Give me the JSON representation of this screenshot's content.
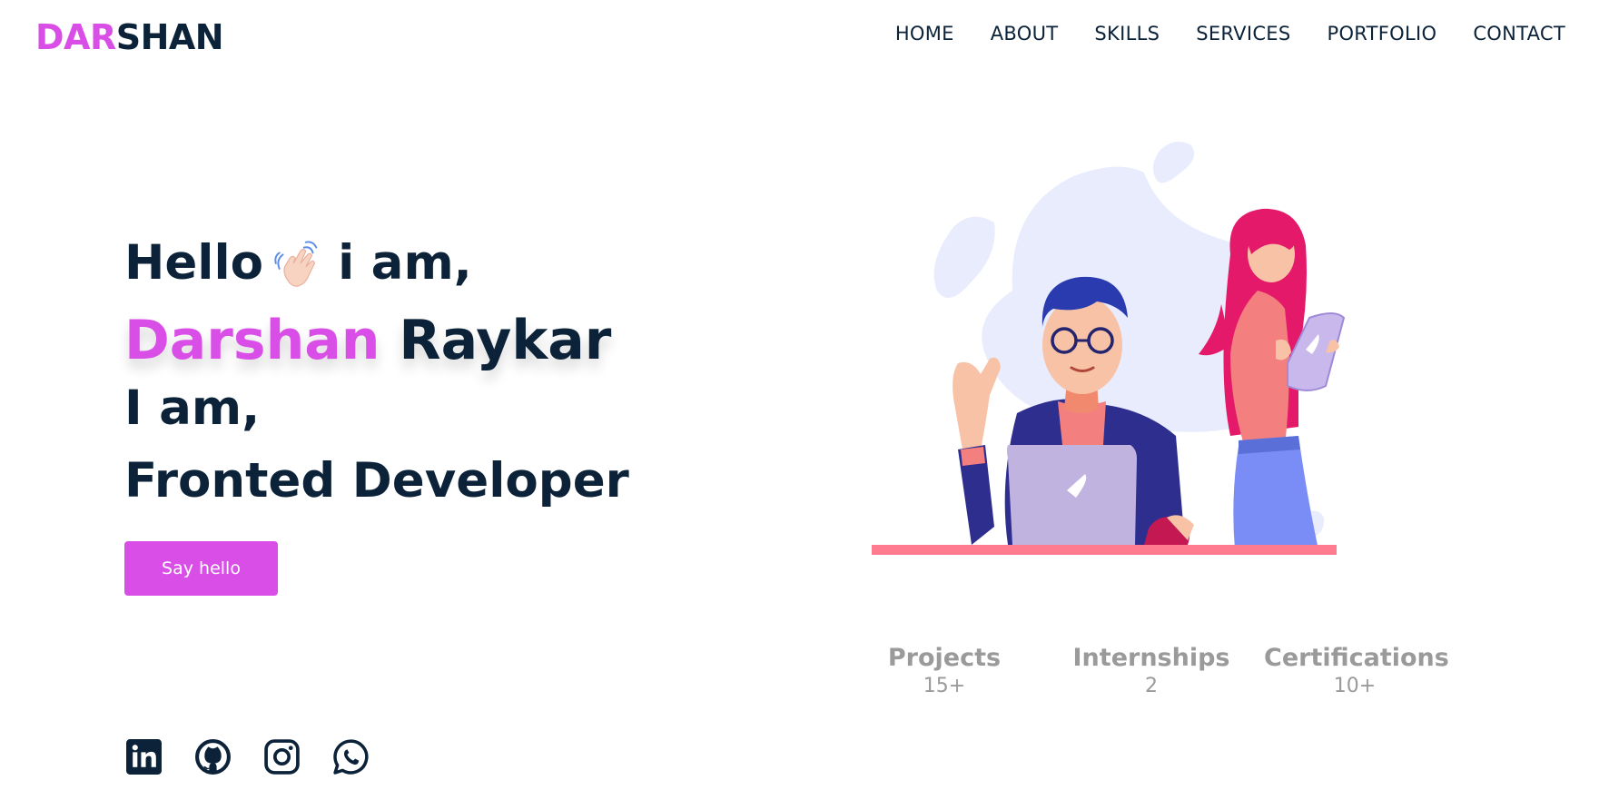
{
  "logo": {
    "accent": "DAR",
    "rest": "SHAN"
  },
  "nav": [
    "HOME",
    "ABOUT",
    "SKILLS",
    "SERVICES",
    "PORTFOLIO",
    "CONTACT"
  ],
  "hero": {
    "line1_pre": "Hello",
    "line1_post": "i am,",
    "first_name": "Darshan",
    "last_name": " Raykar",
    "line3": "I am,",
    "role": "Fronted Developer"
  },
  "cta": {
    "label": "Say hello"
  },
  "socials": [
    "linkedin-icon",
    "github-icon",
    "instagram-icon",
    "whatsapp-icon"
  ],
  "stats": [
    {
      "label": "Projects",
      "value": "15+"
    },
    {
      "label": "Internships",
      "value": "2"
    },
    {
      "label": "Certifications",
      "value": "10+"
    }
  ],
  "colors": {
    "accent": "#d94ee6",
    "text": "#0b2239",
    "muted": "#9a9a9a"
  }
}
